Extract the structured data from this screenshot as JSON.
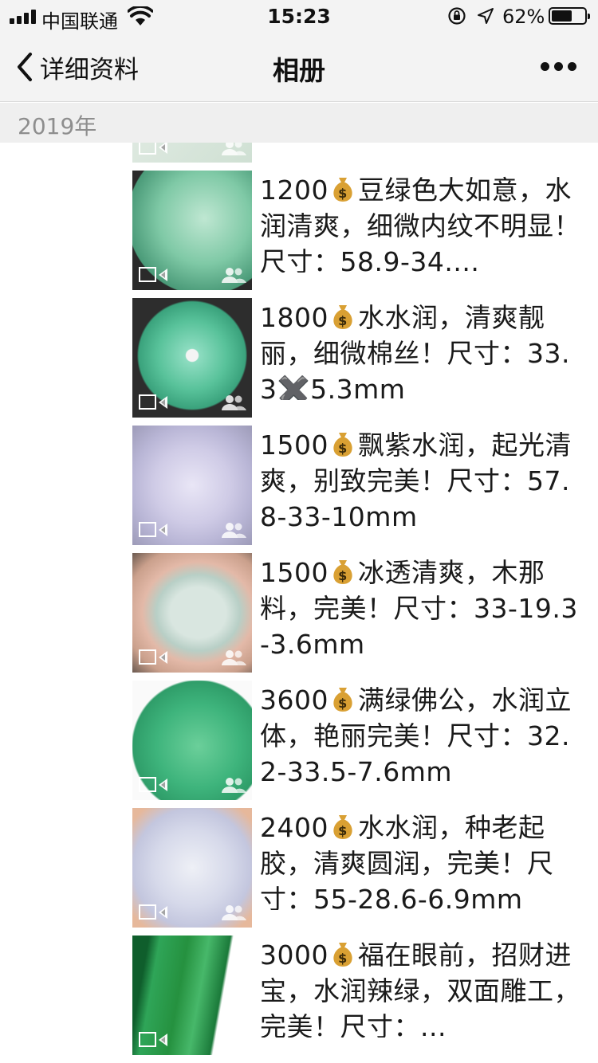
{
  "status_bar": {
    "carrier": "中国联通",
    "time": "15:23",
    "battery_percent": "62%",
    "battery_level": 0.62
  },
  "nav": {
    "back_label": "详细资料",
    "title": "相册"
  },
  "section": {
    "year": "2019年"
  },
  "posts": [
    {
      "price": "",
      "text": "",
      "jade": "green-light"
    },
    {
      "price": "1200",
      "text": "豆绿色大如意，水润清爽，细微内纹不明显！尺寸：58.9-34....",
      "jade": "ruyi"
    },
    {
      "price": "1800",
      "text": "水水润，清爽靓丽，细微棉丝！尺寸：33.3✖️5.3mm",
      "jade": "disc"
    },
    {
      "price": "1500",
      "text": "飘紫水润，起光清爽，别致完美！尺寸：57.8-33-10mm",
      "jade": "lavender"
    },
    {
      "price": "1500",
      "text": "冰透清爽，木那料，完美！尺寸：33-19.3-3.6mm",
      "jade": "ice"
    },
    {
      "price": "3600",
      "text": "满绿佛公，水润立体，艳丽完美！尺寸：32.2-33.5-7.6mm",
      "jade": "buddha"
    },
    {
      "price": "2400",
      "text": "水水润，种老起胶，清爽圆润，完美！尺寸：55-28.6-6.9mm",
      "jade": "guanyin"
    },
    {
      "price": "3000",
      "text": "福在眼前，招财进宝，水润辣绿，双面雕工，完美！尺寸：...",
      "jade": "emerald"
    }
  ],
  "colors": {
    "bar_bg": "#f3f3f3",
    "year_bg": "#efefef",
    "year_text": "#8e8e8e",
    "money_bag": "#d9a033"
  }
}
